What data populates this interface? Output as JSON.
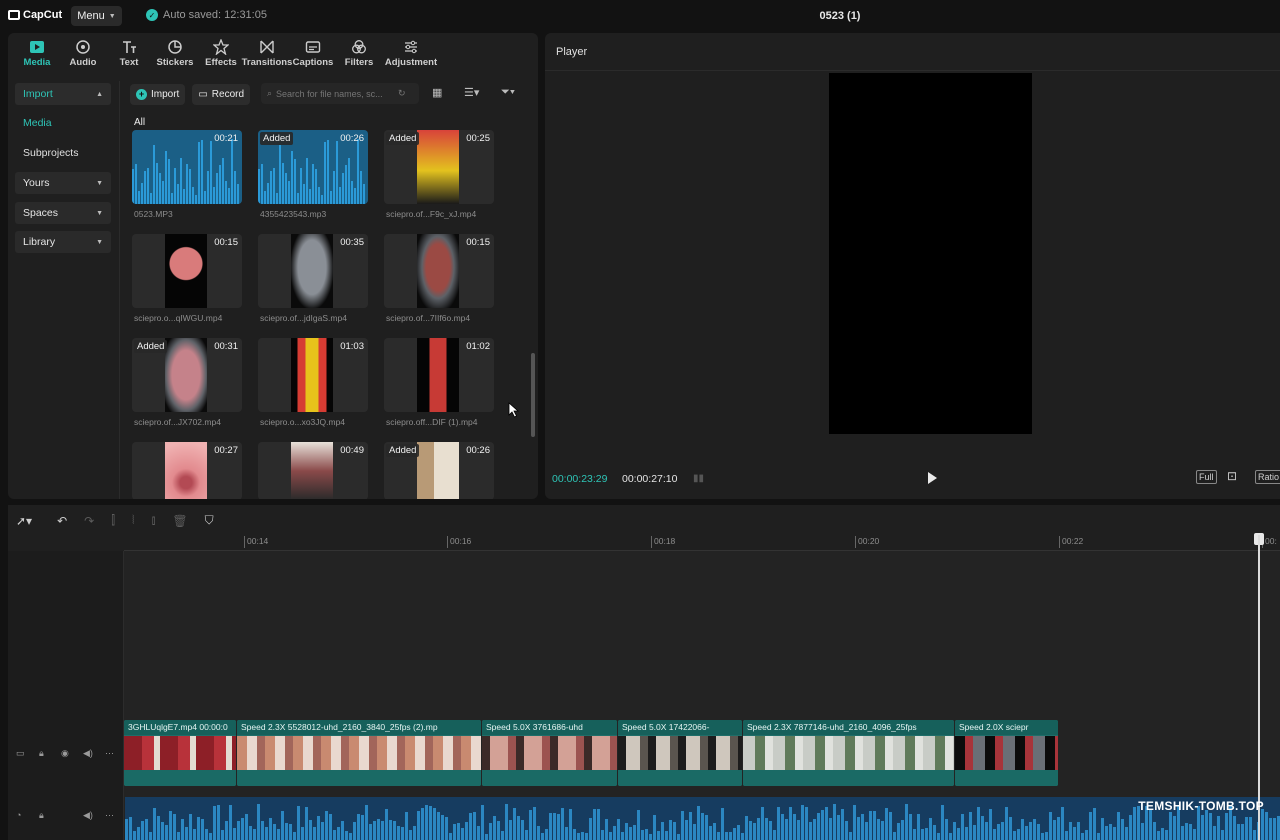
{
  "app": {
    "logo": "CapCut",
    "menu_label": "Menu",
    "autosave": "Auto saved: 12:31:05",
    "project_title": "0523 (1)"
  },
  "toolstrip": [
    {
      "label": "Media",
      "icon": "media-icon"
    },
    {
      "label": "Audio",
      "icon": "audio-icon"
    },
    {
      "label": "Text",
      "icon": "text-icon"
    },
    {
      "label": "Stickers",
      "icon": "stickers-icon"
    },
    {
      "label": "Effects",
      "icon": "effects-icon"
    },
    {
      "label": "Transitions",
      "icon": "transitions-icon"
    },
    {
      "label": "Captions",
      "icon": "captions-icon"
    },
    {
      "label": "Filters",
      "icon": "filters-icon"
    },
    {
      "label": "Adjustment",
      "icon": "adjustment-icon"
    }
  ],
  "sidebar": {
    "import": "Import",
    "media": "Media",
    "subprojects": "Subprojects",
    "yours": "Yours",
    "spaces": "Spaces",
    "library": "Library"
  },
  "media_toolbar": {
    "import_label": "Import",
    "record_label": "Record",
    "search_placeholder": "Search for file names, sc..."
  },
  "all_label": "All",
  "media_items": [
    {
      "name": "0523.MP3",
      "duration": "00:21",
      "added": "",
      "kind": "audio"
    },
    {
      "name": "4355423543.mp3",
      "duration": "00:26",
      "added": "Added",
      "kind": "audio"
    },
    {
      "name": "sciepro.of...F9c_xJ.mp4",
      "duration": "00:25",
      "added": "Added",
      "kind": "video"
    },
    {
      "name": "sciepro.o...qIWGU.mp4",
      "duration": "00:15",
      "added": "",
      "kind": "video"
    },
    {
      "name": "sciepro.of...jdIgaS.mp4",
      "duration": "00:35",
      "added": "",
      "kind": "video"
    },
    {
      "name": "sciepro.of...7IIf6o.mp4",
      "duration": "00:15",
      "added": "",
      "kind": "video"
    },
    {
      "name": "sciepro.of...JX702.mp4",
      "duration": "00:31",
      "added": "Added",
      "kind": "video"
    },
    {
      "name": "sciepro.o...xo3JQ.mp4",
      "duration": "01:03",
      "added": "",
      "kind": "video"
    },
    {
      "name": "sciepro.off...DIF (1).mp4",
      "duration": "01:02",
      "added": "",
      "kind": "video"
    },
    {
      "name": "",
      "duration": "00:27",
      "added": "",
      "kind": "video"
    },
    {
      "name": "",
      "duration": "00:49",
      "added": "",
      "kind": "video"
    },
    {
      "name": "",
      "duration": "00:26",
      "added": "Added",
      "kind": "video"
    }
  ],
  "player": {
    "title": "Player",
    "current_time": "00:00:23:29",
    "total_time": "00:00:27:10",
    "full_label": "Full",
    "ratio_label": "Ratio"
  },
  "timeline": {
    "ruler": [
      "00:14",
      "00:16",
      "00:18",
      "00:20",
      "00:22",
      "00:"
    ],
    "clips": [
      {
        "label": "3GHLUqlgE7.mp4  00:00:0"
      },
      {
        "label": "Speed 2.3X   5528012-uhd_2160_3840_25fps (2).mp"
      },
      {
        "label": "Speed 5.0X   3761686-uhd"
      },
      {
        "label": "Speed 5.0X   17422066-"
      },
      {
        "label": "Speed 2.3X   7877146-uhd_2160_4096_25fps"
      },
      {
        "label": "Speed 2.0X   sciepr"
      }
    ]
  },
  "watermark": "TEMSHIK-TOMB.TOP",
  "colors": {
    "accent": "#2ec4b6",
    "clip": "#1e6e69",
    "audio": "#163c60"
  }
}
